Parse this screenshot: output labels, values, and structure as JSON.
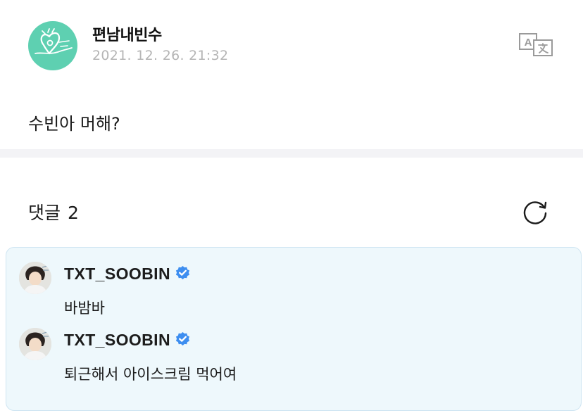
{
  "post": {
    "author": "편남내빈수",
    "timestamp": "2021. 12. 26. 21:32",
    "text": "수빈아 머해?"
  },
  "comments": {
    "label": "댓글",
    "count": "2"
  },
  "replies": [
    {
      "author": "TXT_SOOBIN",
      "text": "바밤바"
    },
    {
      "author": "TXT_SOOBIN",
      "text": "퇴근해서 아이스크림 먹어여"
    }
  ],
  "icons": {
    "translate": "translate-icon",
    "refresh": "refresh-icon",
    "verified": "verified-badge-icon"
  },
  "colors": {
    "avatar_bg": "#5ed0b1",
    "reply_box_bg": "#eef8fc",
    "verified": "#3d8ef0",
    "timestamp": "#b5b5b5"
  }
}
